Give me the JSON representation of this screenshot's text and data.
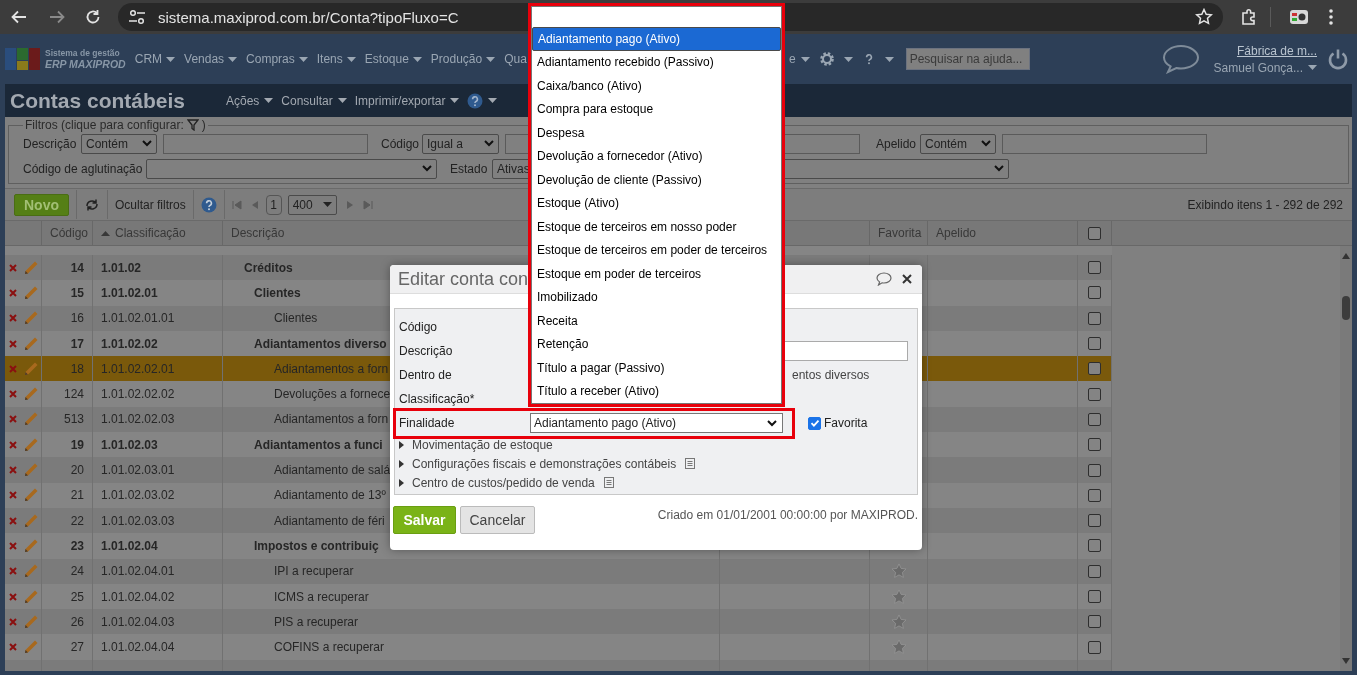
{
  "browser": {
    "url": "sistema.maxiprod.com.br/Conta?tipoFluxo=C"
  },
  "app_header": {
    "logo_line_1": "Sistema de gestão",
    "logo_line_2": "ERP MAXIPROD",
    "menus": [
      {
        "label": "CRM",
        "caret": true
      },
      {
        "label": "Vendas",
        "caret": true
      },
      {
        "label": "Compras",
        "caret": true
      },
      {
        "label": "Itens",
        "caret": true
      },
      {
        "label": "Estoque",
        "caret": true
      },
      {
        "label": "Produção",
        "caret": true
      },
      {
        "label": "Qua",
        "caret": false
      }
    ],
    "menus_right": [
      {
        "label": "e",
        "caret": true
      }
    ],
    "help_search": {
      "placeholder": "Pesquisar na ajuda..."
    },
    "company": "Fábrica de m...",
    "user": "Samuel Gonça..."
  },
  "page": {
    "title": "Contas contábeis",
    "actions": [
      "Ações",
      "Consultar",
      "Imprimir/exportar"
    ]
  },
  "filters": {
    "legend": "Filtros (clique para configurar:",
    "legend_end": ")",
    "row_1": [
      {
        "label": "Descrição",
        "operator": "Contém"
      },
      {
        "label": "Código",
        "operator": "Igual a"
      },
      {
        "label": "Apelido",
        "operator": "Contém"
      }
    ],
    "row_2": [
      {
        "label": "Código de aglutinação"
      },
      {
        "label": "Estado",
        "value": "Ativas"
      }
    ]
  },
  "toolbar": {
    "new_button": "Novo",
    "hide_filters": "Ocultar filtros",
    "page": "1",
    "page_size": "400",
    "summary": "Exibindo itens 1 - 292 de 292"
  },
  "table": {
    "columns": [
      {
        "label": "Código",
        "sorted": false
      },
      {
        "label": "Classificação",
        "sorted": true
      },
      {
        "label": "Descrição",
        "sorted": false
      },
      {
        "label": "Favorita",
        "sorted": false
      },
      {
        "label": "Apelido",
        "sorted": false
      }
    ],
    "select_all": {
      "checked": false
    },
    "rows": [
      {
        "code": "14",
        "classification": "1.01.02",
        "description": "Créditos",
        "kind": "group",
        "selected": false,
        "checked": false,
        "children": [
          {
            "code": "15",
            "classification": "1.01.02.01",
            "description": "Clientes",
            "kind": "group",
            "selected": false,
            "checked": false,
            "children": [
              {
                "code": "16",
                "classification": "1.01.02.01.01",
                "description": "Clientes",
                "kind": "account",
                "selected": false,
                "checked": false
              }
            ]
          },
          {
            "code": "17",
            "classification": "1.01.02.02",
            "description": "Adiantamentos diverso",
            "kind": "group",
            "selected": false,
            "checked": false,
            "children": [
              {
                "code": "18",
                "classification": "1.01.02.02.01",
                "description": "Adiantamentos a forn",
                "kind": "account",
                "selected": true,
                "checked": false
              },
              {
                "code": "124",
                "classification": "1.01.02.02.02",
                "description": "Devoluções a fornece",
                "kind": "account",
                "selected": false,
                "checked": false
              },
              {
                "code": "513",
                "classification": "1.01.02.02.03",
                "description": "Adiantamentos a forn",
                "kind": "account",
                "selected": false,
                "checked": false
              }
            ]
          },
          {
            "code": "19",
            "classification": "1.01.02.03",
            "description": "Adiantamentos a funci",
            "kind": "group",
            "selected": false,
            "checked": false,
            "children": [
              {
                "code": "20",
                "classification": "1.01.02.03.01",
                "description": "Adiantamento de salá",
                "kind": "account",
                "selected": false,
                "checked": false
              },
              {
                "code": "21",
                "classification": "1.01.02.03.02",
                "description": "Adiantamento de 13º",
                "kind": "account",
                "selected": false,
                "checked": false
              },
              {
                "code": "22",
                "classification": "1.01.02.03.03",
                "description": "Adiantamento de féri",
                "kind": "account",
                "selected": false,
                "checked": false
              }
            ]
          },
          {
            "code": "23",
            "classification": "1.01.02.04",
            "description": "Impostos e contribuiç",
            "kind": "group",
            "selected": false,
            "checked": false,
            "children": [
              {
                "code": "24",
                "classification": "1.01.02.04.01",
                "description": "IPI a recuperar",
                "kind": "account",
                "selected": false,
                "checked": false,
                "favorite": false
              },
              {
                "code": "25",
                "classification": "1.01.02.04.02",
                "description": "ICMS a recuperar",
                "kind": "account",
                "selected": false,
                "checked": false,
                "favorite": false
              },
              {
                "code": "26",
                "classification": "1.01.02.04.03",
                "description": "PIS a recuperar",
                "kind": "account",
                "selected": false,
                "checked": false,
                "favorite": false
              },
              {
                "code": "27",
                "classification": "1.01.02.04.04",
                "description": "COFINS a recuperar",
                "kind": "account",
                "selected": false,
                "checked": false,
                "favorite": false
              }
            ]
          }
        ]
      }
    ]
  },
  "dialog": {
    "title": "Editar conta con",
    "fields": [
      {
        "label": "Código",
        "kind": "empty"
      },
      {
        "label": "Descrição",
        "kind": "input"
      },
      {
        "label": "Dentro de",
        "kind": "text",
        "value": "entos diversos"
      },
      {
        "label": "Classificação*",
        "kind": "empty"
      },
      {
        "label": "Finalidade",
        "kind": "select",
        "value": "Adiantamento pago (Ativo)"
      }
    ],
    "favorite": {
      "label": "Favorita",
      "checked": true
    },
    "sections": [
      {
        "label": "Movimentação de estoque",
        "expanded": false,
        "note": false
      },
      {
        "label": "Configurações fiscais e demonstrações contábeis",
        "expanded": false,
        "note": true
      },
      {
        "label": "Centro de custos/pedido de venda",
        "expanded": false,
        "note": true
      }
    ],
    "save_button": "Salvar",
    "cancel_button": "Cancelar",
    "created": "Criado em 01/01/2001 00:00:00 por MAXIPROD."
  },
  "dropdown": {
    "options": [
      {
        "label": "Adiantamento pago (Ativo)",
        "selected": true
      },
      {
        "label": "Adiantamento recebido (Passivo)",
        "selected": false
      },
      {
        "label": "Caixa/banco (Ativo)",
        "selected": false
      },
      {
        "label": "Compra para estoque",
        "selected": false
      },
      {
        "label": "Despesa",
        "selected": false
      },
      {
        "label": "Devolução a fornecedor (Ativo)",
        "selected": false
      },
      {
        "label": "Devolução de cliente (Passivo)",
        "selected": false
      },
      {
        "label": "Estoque (Ativo)",
        "selected": false
      },
      {
        "label": "Estoque de terceiros em nosso poder",
        "selected": false
      },
      {
        "label": "Estoque de terceiros em poder de terceiros",
        "selected": false
      },
      {
        "label": "Estoque em poder de terceiros",
        "selected": false
      },
      {
        "label": "Imobilizado",
        "selected": false
      },
      {
        "label": "Receita",
        "selected": false
      },
      {
        "label": "Retenção",
        "selected": false
      },
      {
        "label": "Título a pagar (Passivo)",
        "selected": false
      },
      {
        "label": "Título a receber (Ativo)",
        "selected": false
      }
    ]
  }
}
